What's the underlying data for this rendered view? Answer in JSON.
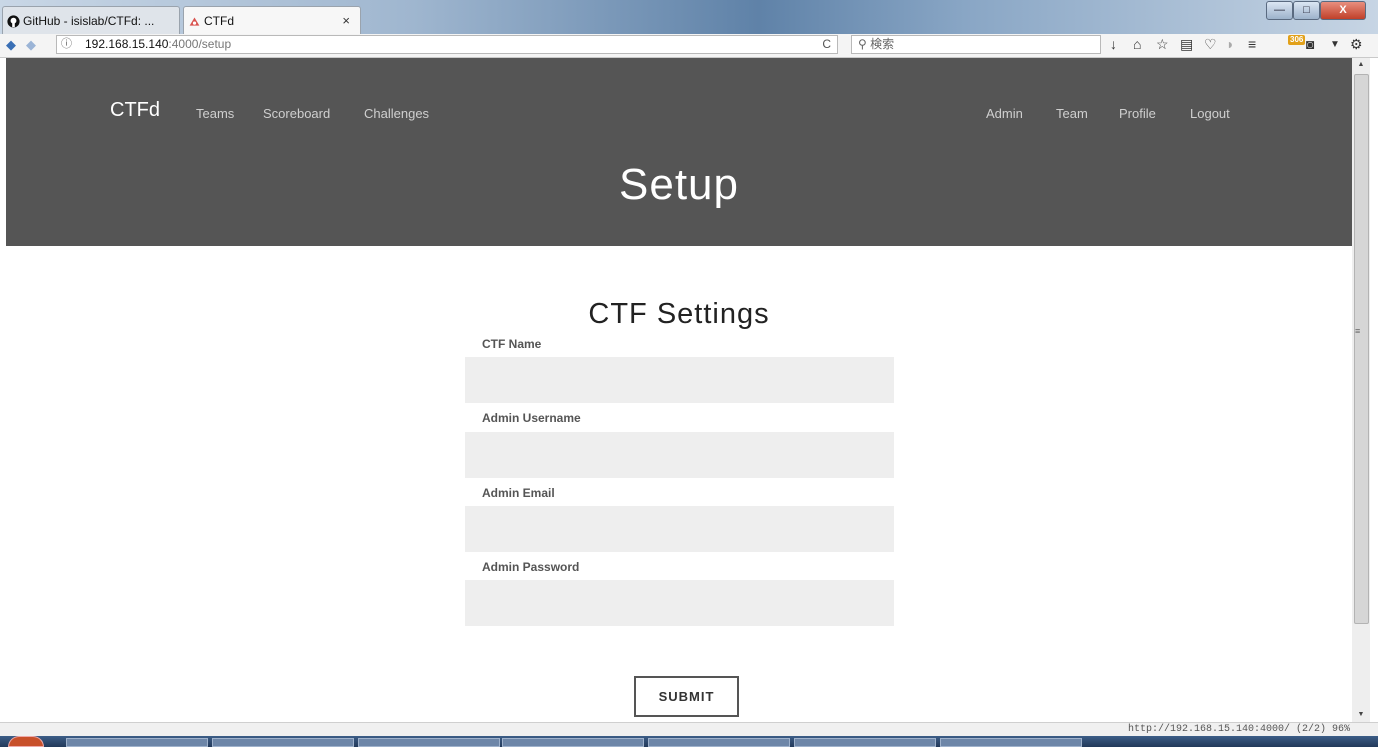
{
  "browser": {
    "tabs": [
      {
        "label": "GitHub - isislab/CTFd: ...",
        "icon": "github-icon"
      },
      {
        "label": "CTFd",
        "icon": "ctfd-icon",
        "close": "×"
      }
    ],
    "url_host": "192.168.15.140",
    "url_path": ":4000/setup",
    "reload": "C",
    "search_placeholder": "検索",
    "toolbar_badge": "306",
    "status_text": "http://192.168.15.140:4000/ (2/2) 96%",
    "window_buttons": {
      "minimize": "—",
      "maximize": "□",
      "close": "X"
    }
  },
  "nav": {
    "brand": "CTFd",
    "left_links": [
      "Teams",
      "Scoreboard",
      "Challenges"
    ],
    "right_links": [
      "Admin",
      "Team",
      "Profile",
      "Logout"
    ]
  },
  "header": {
    "title": "Setup"
  },
  "form": {
    "title": "CTF Settings",
    "fields": [
      {
        "label": "CTF Name",
        "value": ""
      },
      {
        "label": "Admin Username",
        "value": ""
      },
      {
        "label": "Admin Email",
        "value": ""
      },
      {
        "label": "Admin Password",
        "value": ""
      }
    ],
    "submit_label": "SUBMIT"
  },
  "colors": {
    "header_bg": "#555555",
    "input_bg": "#eeeeee",
    "nav_link": "#cfcfcf"
  }
}
